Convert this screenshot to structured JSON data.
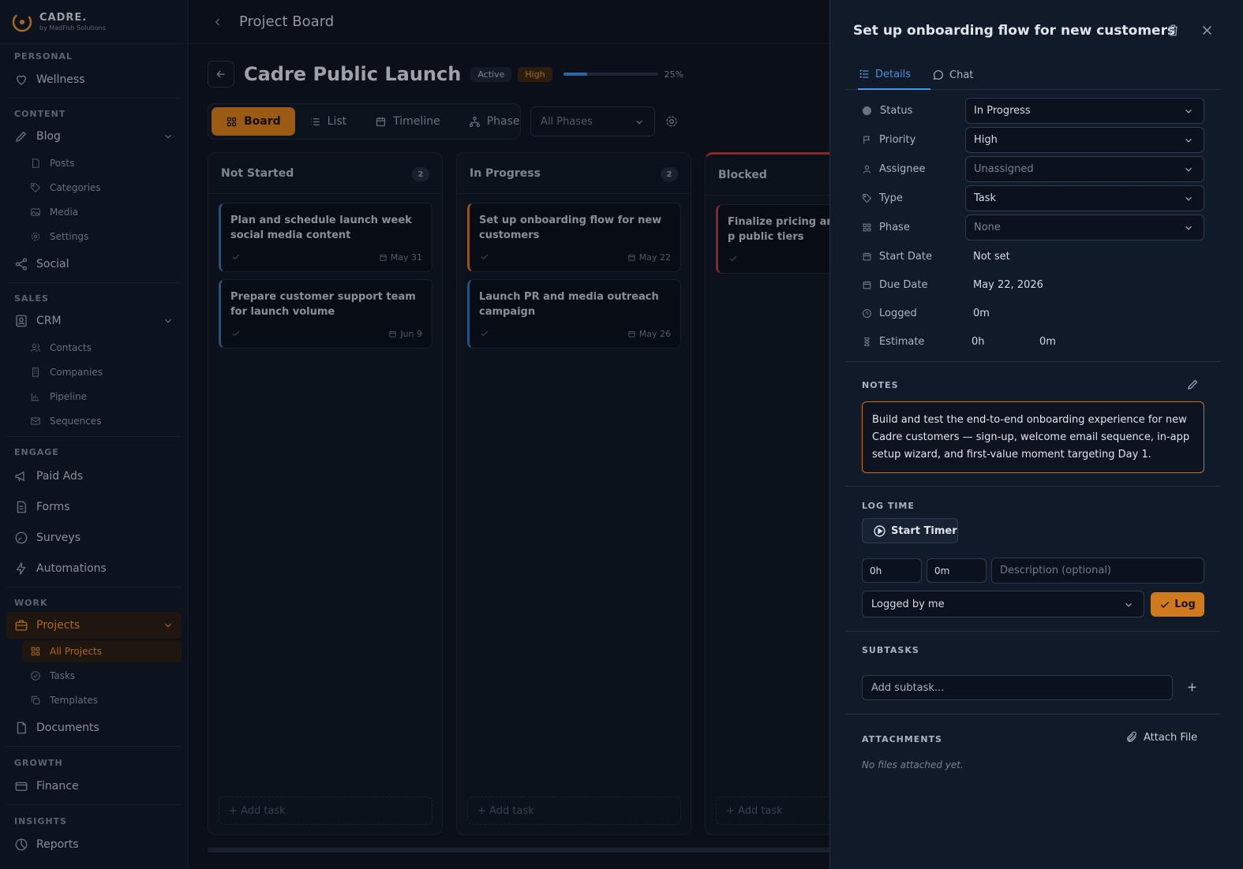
{
  "brand": {
    "name": "CADRE.",
    "sub": "by MadFish Solutions"
  },
  "sidebar": {
    "sections": {
      "personal": "PERSONAL",
      "content": "CONTENT",
      "sales": "SALES",
      "engage": "ENGAGE",
      "work": "WORK",
      "growth": "GROWTH",
      "insights": "INSIGHTS"
    },
    "items": {
      "wellness": "Wellness",
      "blog": "Blog",
      "posts": "Posts",
      "categories": "Categories",
      "media": "Media",
      "settings": "Settings",
      "social": "Social",
      "crm": "CRM",
      "contacts": "Contacts",
      "companies": "Companies",
      "pipeline": "Pipeline",
      "sequences": "Sequences",
      "paid_ads": "Paid Ads",
      "forms": "Forms",
      "surveys": "Surveys",
      "automations": "Automations",
      "projects": "Projects",
      "all_projects": "All Projects",
      "tasks": "Tasks",
      "templates": "Templates",
      "documents": "Documents",
      "finance": "Finance",
      "reports": "Reports"
    }
  },
  "topbar": {
    "title": "Project Board"
  },
  "project": {
    "title": "Cadre Public Launch",
    "status_badge": "Active",
    "priority_badge": "High",
    "progress": 25,
    "progress_label": "25%"
  },
  "views": {
    "board": "Board",
    "list": "List",
    "timeline": "Timeline",
    "phase": "Phase"
  },
  "phase_filter": "All Phases",
  "columns": [
    {
      "name": "Not Started",
      "count": "2",
      "cards": [
        {
          "title": "Plan and schedule launch week social media content",
          "date": "May 31"
        },
        {
          "title": "Prepare customer support team for launch volume",
          "date": "Jun 9"
        }
      ],
      "add_label": "+ Add task"
    },
    {
      "name": "In Progress",
      "count": "2",
      "cards": [
        {
          "title": "Set up onboarding flow for new customers",
          "date": "May 22"
        },
        {
          "title": "Launch PR and media outreach campaign",
          "date": "May 26"
        }
      ],
      "add_label": "+ Add task"
    },
    {
      "name": "Blocked",
      "cards": [
        {
          "title": "Finalize pricing and p public tiers"
        }
      ],
      "add_label": "+ Add task"
    }
  ],
  "drawer": {
    "title": "Set up onboarding flow for new customers",
    "tabs": {
      "details": "Details",
      "chat": "Chat"
    },
    "fields": {
      "status": {
        "label": "Status",
        "value": "In Progress"
      },
      "priority": {
        "label": "Priority",
        "value": "High"
      },
      "assignee": {
        "label": "Assignee",
        "value": "Unassigned"
      },
      "type": {
        "label": "Type",
        "value": "Task"
      },
      "phase": {
        "label": "Phase",
        "value": "None"
      },
      "start_date": {
        "label": "Start Date",
        "value": "Not set"
      },
      "due_date": {
        "label": "Due Date",
        "value": "May 22, 2026"
      },
      "logged": {
        "label": "Logged",
        "value": "0m"
      },
      "estimate": {
        "label": "Estimate",
        "hours": "0h",
        "minutes": "0m"
      }
    },
    "notes": {
      "label": "NOTES",
      "text": "Build and test the end-to-end onboarding experience for new Cadre customers — sign-up, welcome email sequence, in-app setup wizard, and first-value moment targeting Day 1."
    },
    "log_time": {
      "label": "LOG TIME",
      "start_timer": "Start Timer",
      "hours": "0h",
      "minutes": "0m",
      "description_placeholder": "Description (optional)",
      "logged_by": "Logged by me",
      "log_button": "Log"
    },
    "subtasks": {
      "label": "SUBTASKS",
      "placeholder": "Add subtask..."
    },
    "attachments": {
      "label": "ATTACHMENTS",
      "attach_button": "Attach File",
      "empty": "No files attached yet."
    }
  },
  "colors": {
    "accent": "#d07a1d",
    "link": "#4a95e0",
    "blocked": "#b83434",
    "in_progress": "#c27426",
    "not_started": "#2f6fa8"
  }
}
